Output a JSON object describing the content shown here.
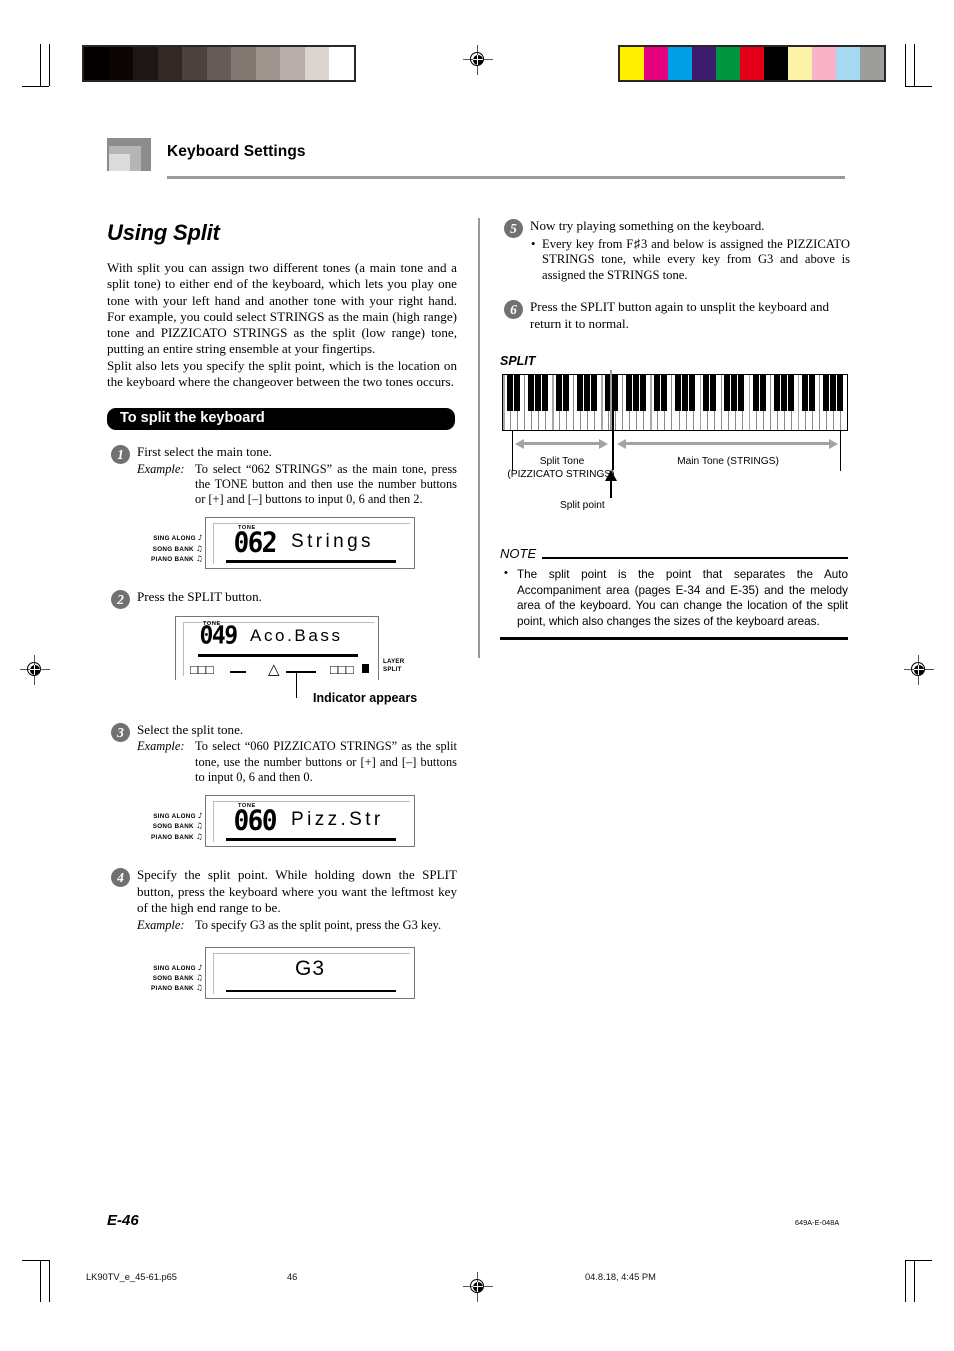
{
  "header": {
    "title": "Keyboard Settings"
  },
  "left_column": {
    "section_title": "Using Split",
    "intro_paragraph_1": "With split you can assign two different tones (a main tone and a split tone) to either end of the keyboard, which lets you play one tone with your left hand and another tone with your right hand. For example, you could select STRINGS as the main (high range) tone and PIZZICATO STRINGS as the split (low range) tone, putting an entire string ensemble at your fingertips.",
    "intro_paragraph_2": "Split also lets you specify the split point, which is the location on the keyboard where the changeover between the two tones occurs.",
    "procedure_bar": "To split the keyboard",
    "steps": [
      {
        "number": "1",
        "text": "First select the main tone.",
        "example_label": "Example:",
        "example_text": "To select “062 STRINGS” as the main tone, press the TONE button and then use the number buttons or [+] and [–] buttons to input 0, 6 and then 2."
      },
      {
        "number": "2",
        "text": "Press the SPLIT button."
      },
      {
        "number": "3",
        "text": "Select the split tone.",
        "example_label": "Example:",
        "example_text": "To select “060 PIZZICATO STRINGS” as the split tone, use the number buttons or [+] and [–] buttons to input 0, 6 and then 0."
      },
      {
        "number": "4",
        "text": "Specify the split point. While holding down the SPLIT button, press the keyboard where you want the leftmost key of the high end range to be.",
        "example_label": "Example:",
        "example_text": "To specify G3 as the split point, press the G3 key."
      }
    ],
    "displays": {
      "side_labels": [
        "SING ALONG",
        "SONG BANK",
        "PIANO BANK"
      ],
      "note_glyphs": [
        "♪",
        "♫",
        "♫"
      ],
      "display_1": {
        "tone_label": "TONE",
        "number": "062",
        "name": "Strings"
      },
      "display_2": {
        "tone_label": "TONE",
        "number": "049",
        "name": "Aco.Bass",
        "layer_label": "LAYER",
        "split_label": "SPLIT",
        "indicator_caption": "Indicator appears"
      },
      "display_3": {
        "tone_label": "TONE",
        "number": "060",
        "name": "Pizz.Str"
      },
      "display_4": {
        "value": "G3"
      }
    }
  },
  "right_column": {
    "steps": [
      {
        "number": "5",
        "text": "Now try playing something on the keyboard.",
        "bullet": "Every key from F♯3 and below is assigned the PIZZICATO STRINGS tone, while every key from G3 and above is assigned the STRINGS tone."
      },
      {
        "number": "6",
        "text": "Press the SPLIT button again to unsplit the keyboard and return it to normal."
      }
    ],
    "figure": {
      "title": "SPLIT",
      "split_tone_label": "Split Tone",
      "split_tone_sub": "(PIZZICATO STRINGS)",
      "main_tone_label": "Main Tone (STRINGS)",
      "split_point_label": "Split point"
    },
    "note": {
      "heading": "NOTE",
      "bullet": "•",
      "text": "The split point is the point that separates the Auto Accompaniment area (pages E-34 and E-35) and the melody area of the keyboard. You can change the location of the split point, which also changes the sizes of the keyboard areas."
    }
  },
  "footer": {
    "folio": "E-46",
    "part_number": "649A-E-048A",
    "file_name": "LK90TV_e_45-61.p65",
    "page_number": "46",
    "timestamp": "04.8.18, 4:45 PM"
  },
  "calibration": {
    "gray_swatches": [
      "#050000",
      "#0a0403",
      "#1d1614",
      "#322926",
      "#4b413d",
      "#665b56",
      "#837771",
      "#9e948e",
      "#b7aea9",
      "#dad5d0",
      "#ffffff"
    ],
    "color_swatches": [
      "#fff000",
      "#e5007e",
      "#009fe3",
      "#3d1c70",
      "#009640",
      "#e30016",
      "#000000",
      "#fbf2a8",
      "#f8b3c8",
      "#a5d8f3",
      "#9d9d9c"
    ]
  }
}
